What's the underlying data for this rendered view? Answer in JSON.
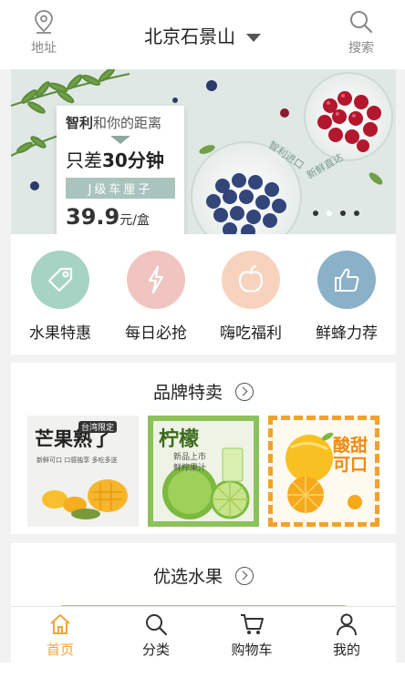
{
  "header": {
    "address_label": "地址",
    "city": "北京石景山",
    "search_label": "搜索"
  },
  "banner": {
    "line1_highlight": "智利",
    "line1_rest": "和你的距离",
    "line2_prefix": "只差",
    "line2_bold": "30分钟",
    "tag": "J级车厘子",
    "price_num": "39.9",
    "price_unit": "元/盒",
    "stamp1": "智利进口",
    "stamp2": "新鲜直达",
    "slides": 4,
    "active_slide": 2
  },
  "categories": [
    {
      "label": "水果特惠",
      "icon": "tag-icon",
      "color": "#a7d3c5"
    },
    {
      "label": "每日必抢",
      "icon": "lightning-icon",
      "color": "#f0c4c0"
    },
    {
      "label": "嗨吃福利",
      "icon": "apple-icon",
      "color": "#f7d3be"
    },
    {
      "label": "鲜蜂力荐",
      "icon": "thumbs-up-icon",
      "color": "#8bb1c8"
    }
  ],
  "brand": {
    "title": "品牌特卖",
    "tiles": [
      {
        "title": "芒果熟了",
        "badge": "台湾限定",
        "sub": "新鲜可口 口感独享 多吃多送"
      },
      {
        "title": "柠檬",
        "sub": "新品上市",
        "sub2": "鲜榨果汁"
      },
      {
        "title": "酸甜可口",
        "sub": ""
      }
    ]
  },
  "select": {
    "title": "优选水果"
  },
  "tabbar": {
    "items": [
      {
        "label": "首页",
        "icon": "home-icon"
      },
      {
        "label": "分类",
        "icon": "search-icon"
      },
      {
        "label": "购物车",
        "icon": "cart-icon"
      },
      {
        "label": "我的",
        "icon": "user-icon"
      }
    ],
    "active_color": "#f0a53a"
  }
}
